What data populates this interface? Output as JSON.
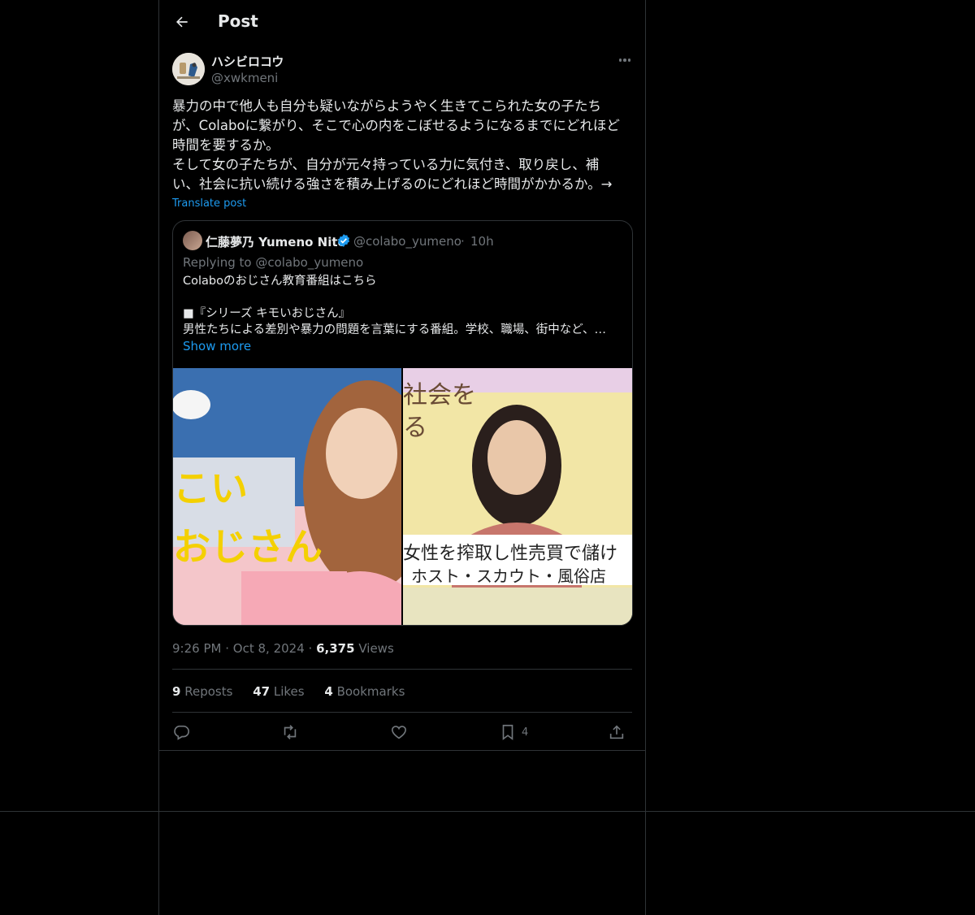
{
  "header": {
    "title": "Post"
  },
  "author": {
    "name": "ハシビロコウ",
    "handle": "@xwkmeni"
  },
  "tweet": {
    "text": "暴力の中で他人も自分も疑いながらようやく生きてこられた女の子たち\nが、Colaboに繋がり、そこで心の内をこぼせるようになるまでにどれほど\n時間を要するか。\nそして女の子たちが、自分が元々持っている力に気付き、取り戻し、補\nい、社会に抗い続ける強さを積み上げるのにどれほど時間がかかるか。→",
    "translate": "Translate post"
  },
  "quote": {
    "name": "仁藤夢乃 Yumeno Nito",
    "handle": "@colabo_yumeno",
    "separator": "·",
    "time": "10h",
    "replying": "Replying to @colabo_yumeno",
    "text": "Colaboのおじさん教育番組はこちら\n\n■『シリーズ キモいおじさん』\n男性たちによる差別や暴力の問題を言葉にする番組。学校、職場、街中など、…",
    "show_more": "Show more",
    "media_left_caption": "こい\nおじさん",
    "media_right_top": "社会を\nる",
    "media_right_caption1": "女性を搾取し性売買で儲け",
    "media_right_caption2": "ホスト・スカウト・風俗店"
  },
  "meta": {
    "time": "9:26 PM",
    "sep1": "·",
    "date": "Oct 8, 2024",
    "sep2": "·",
    "views_count": "6,375",
    "views_label": "Views"
  },
  "stats": {
    "reposts_count": "9",
    "reposts_label": "Reposts",
    "likes_count": "47",
    "likes_label": "Likes",
    "bookmarks_count": "4",
    "bookmarks_label": "Bookmarks"
  },
  "actions": {
    "bookmark_count": "4"
  },
  "colors": {
    "background": "#000000",
    "text": "#e7e9ea",
    "muted": "#71767b",
    "accent": "#1d9bf0",
    "border": "#2f3336"
  },
  "icons": [
    "back-arrow-icon",
    "more-icon",
    "verified-badge-icon",
    "reply-icon",
    "repost-icon",
    "like-icon",
    "bookmark-icon",
    "share-icon"
  ]
}
